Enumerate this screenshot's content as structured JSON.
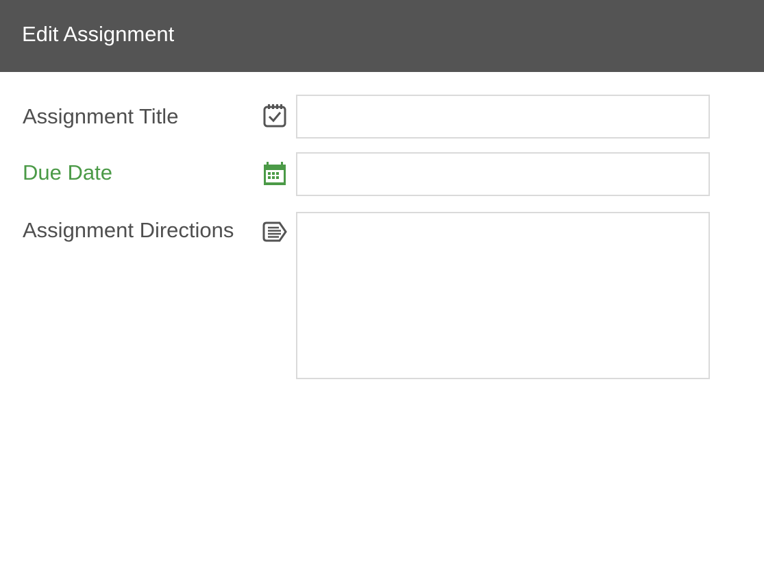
{
  "header": {
    "title": "Edit Assignment"
  },
  "form": {
    "title_row": {
      "label": "Assignment Title",
      "icon": "calendar-check-icon",
      "value": "",
      "label_color": "#4f4f4f"
    },
    "due_date_row": {
      "label": "Due Date",
      "icon": "calendar-grid-icon",
      "value": "",
      "label_color": "#4b9a47"
    },
    "directions_row": {
      "label": "Assignment Directions",
      "icon": "text-tag-icon",
      "value": "",
      "label_color": "#4f4f4f"
    }
  },
  "colors": {
    "header_bg": "#545454",
    "accent_green": "#4b9a47",
    "field_border": "#dadada"
  }
}
